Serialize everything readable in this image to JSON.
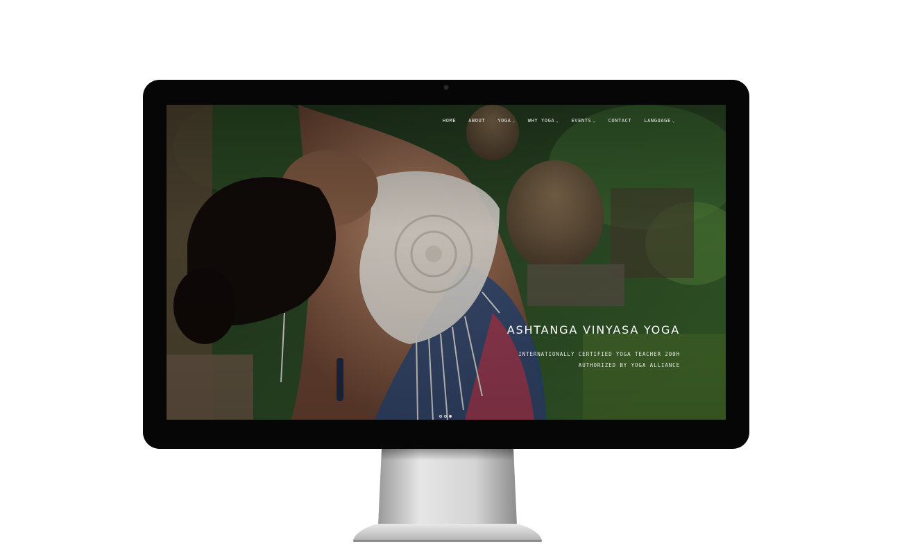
{
  "nav": {
    "items": [
      {
        "label": "HOME",
        "dropdown": false
      },
      {
        "label": "ABOUT",
        "dropdown": false
      },
      {
        "label": "YOGA",
        "dropdown": true
      },
      {
        "label": "WHY YOGA",
        "dropdown": true
      },
      {
        "label": "EVENTS",
        "dropdown": true
      },
      {
        "label": "CONTACT",
        "dropdown": false
      },
      {
        "label": "LANGUAGE",
        "dropdown": true
      }
    ],
    "caret": "⌄"
  },
  "hero": {
    "title": "ASHTANGA VINYASA YOGA",
    "subtitle_line1": "INTERNATIONALLY CERTIFIED YOGA TEACHER 200H",
    "subtitle_line2": "AUTHORIZED BY YOGA ALLIANCE"
  },
  "slider": {
    "dot_count": 3,
    "active_index": 2
  },
  "colors": {
    "bezel": "#060606",
    "text": "#ffffff",
    "foliage": "#2f5a2c"
  }
}
